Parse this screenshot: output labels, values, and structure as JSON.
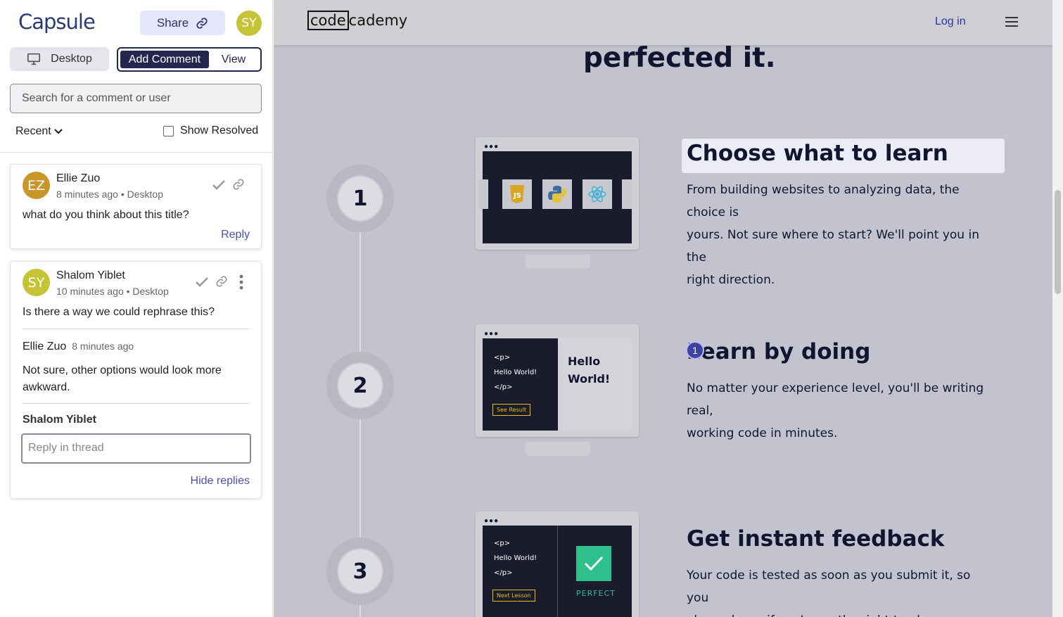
{
  "panel": {
    "logo": "Capsule",
    "share_label": "Share",
    "user_initials": "SY",
    "device_label": "Desktop",
    "add_comment_label": "Add Comment",
    "view_label": "View",
    "search_placeholder": "Search for a comment or user",
    "sort_label": "Recent",
    "show_resolved_label": "Show Resolved",
    "comments": [
      {
        "initials": "EZ",
        "avatar_color": "#c9962a",
        "author": "Ellie Zuo",
        "meta": "8 minutes ago • Desktop",
        "text": "what do you think about this title?",
        "reply_label": "Reply"
      },
      {
        "initials": "SY",
        "avatar_color": "#c5c436",
        "author": "Shalom Yiblet",
        "meta": "10 minutes ago • Desktop",
        "text": "Is there a way we could rephrase this?",
        "reply": {
          "author": "Ellie Zuo",
          "time": "8 minutes ago",
          "text_line1": "Not sure, other options would look more",
          "text_line2": "awkward."
        },
        "reply_author": "Shalom Yiblet",
        "reply_placeholder": "Reply in thread",
        "hide_replies_label": "Hide replies"
      }
    ]
  },
  "site": {
    "logo_boxed": "code",
    "logo_rest": "cademy",
    "login_label": "Log in",
    "hero_title": "perfected it.",
    "steps": [
      {
        "number": "1",
        "heading": "Choose what to learn",
        "para_lines": [
          "From building websites to analyzing data, the choice is",
          "yours. Not sure where to start? We'll point you in the",
          "right direction."
        ]
      },
      {
        "number": "2",
        "heading": "Learn by doing",
        "para_lines": [
          "No matter your experience level, you'll be writing real,",
          "working code in minutes."
        ],
        "code_lines": [
          "<p>",
          "Hello World!",
          "</p>"
        ],
        "button": "See Result",
        "preview_line1": "Hello",
        "preview_line2": "World!"
      },
      {
        "number": "3",
        "heading": "Get instant feedback",
        "para_lines": [
          "Your code is tested as soon as you submit it, so you",
          "always know if you're on the right track."
        ],
        "code_lines": [
          "<p>",
          "Hello World!",
          "</p>"
        ],
        "button": "Next Lesson",
        "result_label": "PERFECT"
      }
    ],
    "pin_number": "1"
  },
  "colors": {
    "accent": "#23264f",
    "link": "#4a4fb0",
    "overlay": "#c3c3cf",
    "perfect_green": "#2dbf8c"
  }
}
